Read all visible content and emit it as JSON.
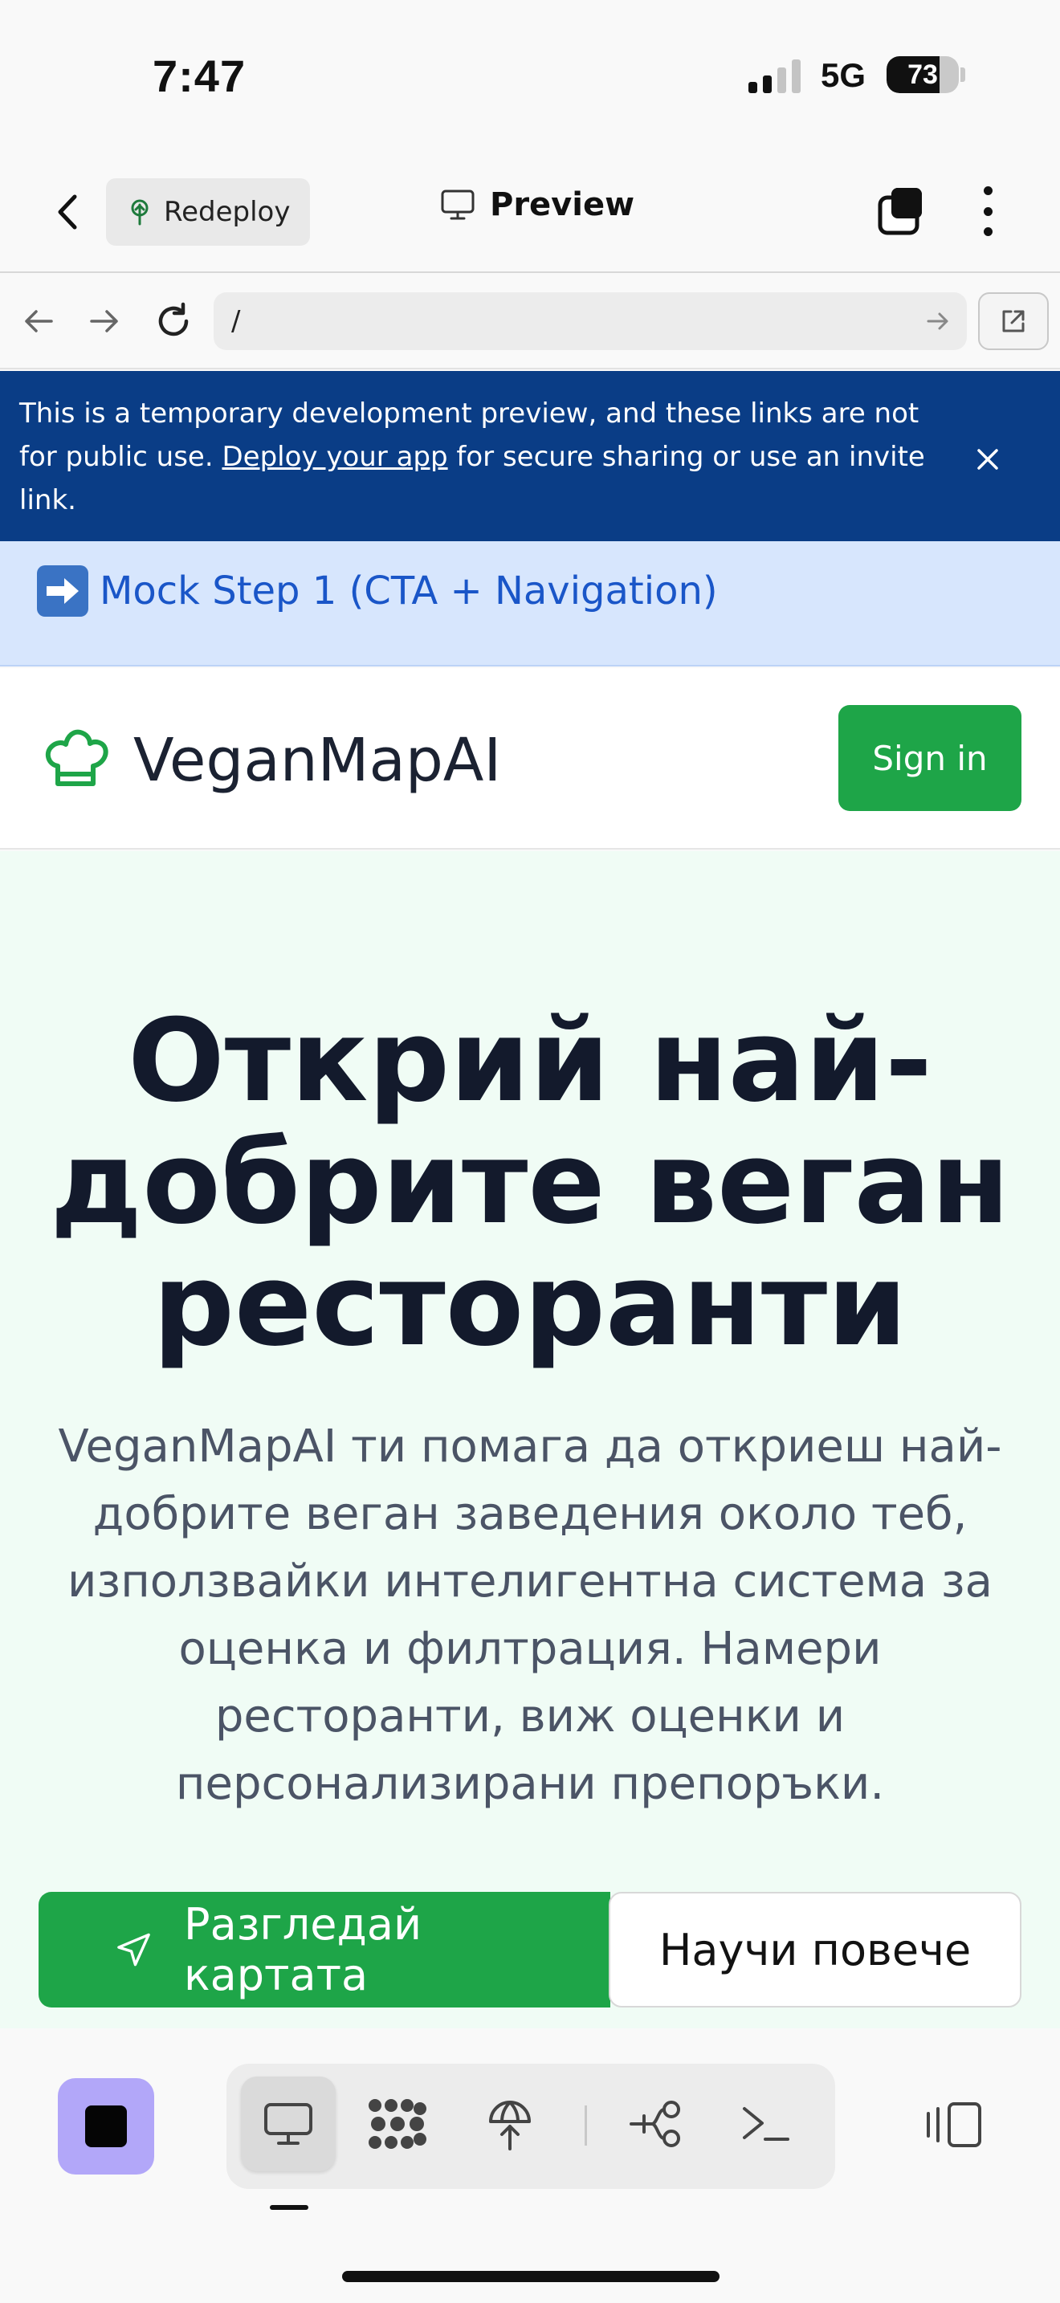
{
  "status_bar": {
    "time": "7:47",
    "network": "5G",
    "battery": "73",
    "battery_level": 0.73
  },
  "header": {
    "back_icon": "chevron-left-icon",
    "redeploy_label": "Redeploy",
    "preview_label": "Preview",
    "tabs_icon": "tabs-icon",
    "more_icon": "more-vertical-icon"
  },
  "browser": {
    "url": "/",
    "back_icon": "arrow-left-icon",
    "forward_icon": "arrow-right-icon",
    "reload_icon": "reload-icon",
    "open_external_icon": "external-link-icon"
  },
  "dev_banner": {
    "text_before": "This is a temporary development preview, and these links are not for public use. ",
    "link": "Deploy your app",
    "text_after": " for secure sharing or use an invite link."
  },
  "mock_step": {
    "label": "Mock Step 1 (CTA + Navigation)"
  },
  "site_nav": {
    "brand": "VeganMapAI",
    "signin_label": "Sign in"
  },
  "hero": {
    "title_lines": [
      "Открий най-",
      "добрите веган",
      "ресторанти"
    ],
    "description_lines": [
      "VeganMapAI ти помага да откриеш най-",
      "добрите веган заведения около теб,",
      "използвайки интелигентна система за",
      "оценка и филтрация. Намери",
      "ресторанти, виж оценки и",
      "персонализирани препоръки."
    ],
    "primary_cta": "Разгледай картата",
    "secondary_cta": "Научи повече"
  },
  "toolbar": {
    "items": [
      "preview-icon",
      "workspace-icon",
      "deploy-icon",
      "git-icon",
      "shell-icon"
    ],
    "active": "preview-icon"
  },
  "colors": {
    "banner": "#0a3d86",
    "mock_bar": "#d7e6fd",
    "brand_green": "#1ea548",
    "hero_bg": "#f0fcf5",
    "stop_button": "#b2a7f9"
  }
}
